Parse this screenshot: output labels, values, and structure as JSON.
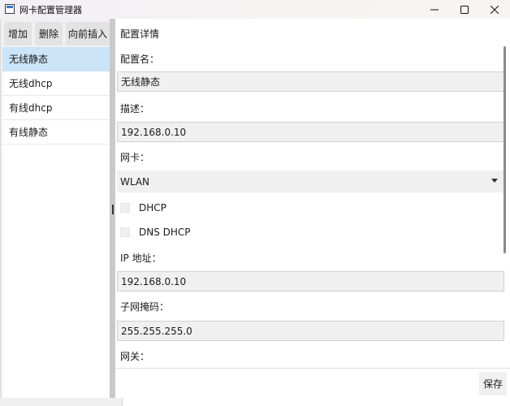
{
  "window": {
    "title": "网卡配置管理器"
  },
  "toolbar": {
    "add_label": "增加",
    "delete_label": "删除",
    "insert_before_label": "向前插入"
  },
  "configs": [
    {
      "label": "无线静态",
      "selected": true
    },
    {
      "label": "无线dhcp",
      "selected": false
    },
    {
      "label": "有线dhcp",
      "selected": false
    },
    {
      "label": "有线静态",
      "selected": false
    }
  ],
  "detail": {
    "section_title": "配置详情",
    "name_label": "配置名：",
    "name_value": "无线静态",
    "desc_label": "描述：",
    "desc_value": "192.168.0.10",
    "nic_label": "网卡：",
    "nic_value": "WLAN",
    "dhcp_label": "DHCP",
    "dhcp_checked": false,
    "dns_dhcp_label": "DNS DHCP",
    "dns_dhcp_checked": false,
    "ip_label": "IP 地址：",
    "ip_value": "192.168.0.10",
    "mask_label": "子网掩码：",
    "mask_value": "255.255.255.0",
    "gateway_label": "网关："
  },
  "footer": {
    "save_label": "保存"
  }
}
